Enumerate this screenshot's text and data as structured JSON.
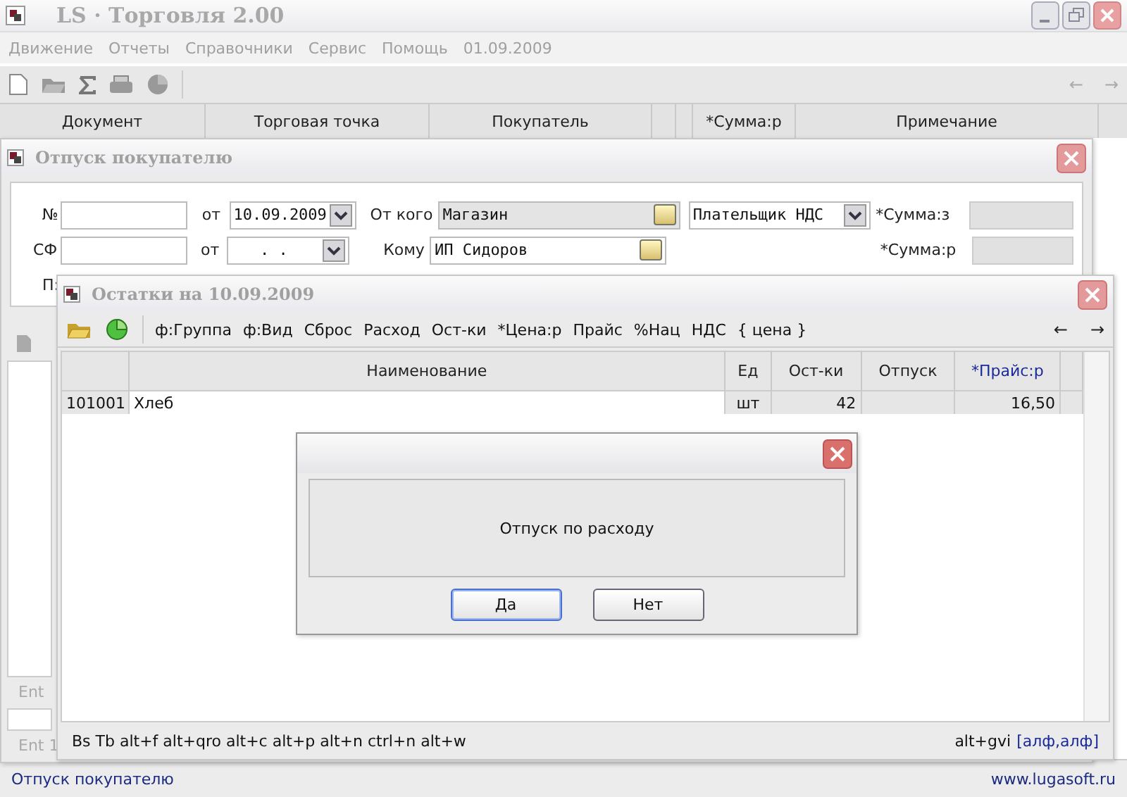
{
  "app": {
    "title": "LS · Торговля 2.00",
    "menu": [
      "Движение",
      "Отчеты",
      "Справочники",
      "Сервис",
      "Помощь",
      "01.09.2009"
    ],
    "nav": [
      "←",
      "→"
    ],
    "columns": [
      {
        "kind": "text",
        "label": "Документ"
      },
      {
        "kind": "text",
        "label": "Торговая точка"
      },
      {
        "kind": "text",
        "label": "Покупатель"
      },
      {
        "kind": "blank"
      },
      {
        "kind": "blank"
      },
      {
        "kind": "text",
        "label": "*Сумма:р"
      },
      {
        "kind": "text",
        "label": "Примечание"
      }
    ]
  },
  "doc_window": {
    "title": "Отпуск покупателю",
    "number_label": "№",
    "from_label": "от",
    "date": "10.09.2009",
    "sender_label": "От кого",
    "sender": "Магазин",
    "vat_status": "Плательщик НДС",
    "sum_label": "*Сумма:з",
    "invoice_label": "СФ",
    "invoice_from_label": "от",
    "invoice_date": ".   .",
    "recipient_label": "Кому",
    "recipient": "ИП Сидоров",
    "sum2_label": "*Сумма:р",
    "p_label": "П:",
    "hint": "Ent",
    "hint2": "Ent 1"
  },
  "stock_window": {
    "title": "Остатки на  10.09.2009",
    "toolbar": [
      "ф:Группа",
      "ф:Вид",
      "Сброс",
      "Расход",
      "Ост-ки",
      "*Цена:р",
      "Прайс",
      "%Нац",
      "НДС",
      "{ цена }"
    ],
    "nav": [
      "←",
      "→"
    ],
    "columns": [
      {
        "label": "Наименование",
        "highlight": false
      },
      {
        "label": "Ед",
        "highlight": false
      },
      {
        "label": "Ост-ки",
        "highlight": false
      },
      {
        "label": "Отпуск",
        "highlight": false
      },
      {
        "label": "*Прайс:р",
        "highlight": true
      }
    ],
    "rows": [
      {
        "code": "101001",
        "name": "Хлеб",
        "unit": "шт",
        "stock": "42",
        "price": "16,50"
      }
    ],
    "shortcuts": "Bs Tb alt+f alt+qro alt+c alt+p alt+n ctrl+n alt+w",
    "layout_keys": "alt+gvi",
    "layout": "[алф,алф]"
  },
  "dialog": {
    "message": "Отпуск по расходу",
    "buttons": [
      {
        "label": "Да",
        "selected": true
      },
      {
        "label": "Нет",
        "selected": false
      }
    ]
  },
  "status_bar": {
    "left": "Отпуск покупателю",
    "right": "www.lugasoft.ru"
  }
}
